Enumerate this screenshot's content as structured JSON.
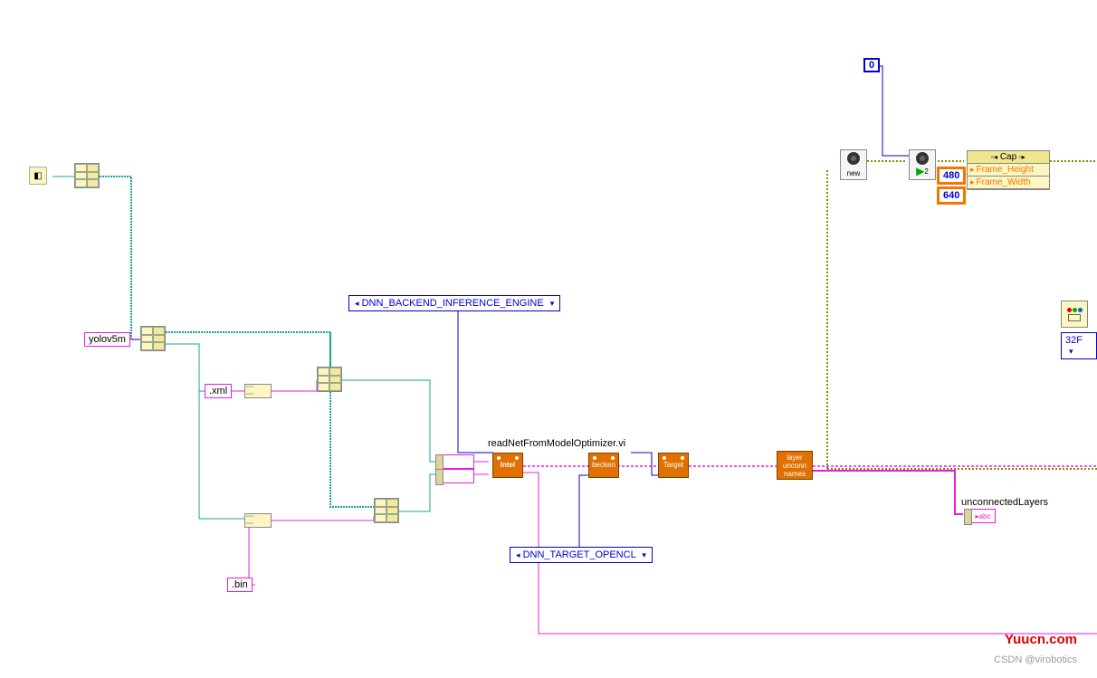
{
  "constants": {
    "yolo": "yolov5m",
    "xml": ".xml",
    "bin": ".bin",
    "backend": "DNN_BACKEND_INFERENCE_ENGINE",
    "target": "DNN_TARGET_OPENCL",
    "zero": "0",
    "width": "640",
    "height": "480",
    "format": "32F"
  },
  "nodes": {
    "readnet": "readNetFromModelOptimizer.vi",
    "intel": "Intel",
    "becken": "becken",
    "targetnode": "Target",
    "layers": "layer\nunconn\nnames",
    "cam_new": "new",
    "cam_play": "2"
  },
  "prop": {
    "title": "Cap",
    "row1": "Frame_Height",
    "row2": "Frame_Width"
  },
  "outputs": {
    "unconnected": "unconnectedLayers",
    "abc": "abc"
  },
  "footer": {
    "site": "Yuucn.com",
    "credit": "CSDN @virobotics"
  }
}
